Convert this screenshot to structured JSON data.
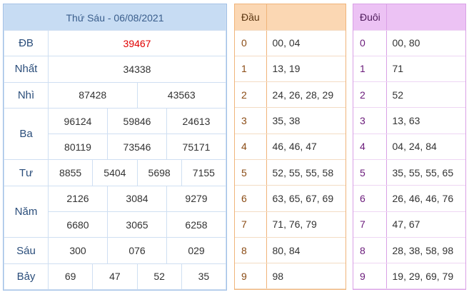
{
  "results": {
    "title": "Thứ Sáu - 06/08/2021",
    "labels": {
      "db": "ĐB",
      "nhat": "Nhất",
      "nhi": "Nhì",
      "ba": "Ba",
      "tu": "Tư",
      "nam": "Năm",
      "sau": "Sáu",
      "bay": "Bảy"
    },
    "db": "39467",
    "nhat": "34338",
    "nhi": [
      "87428",
      "43563"
    ],
    "ba": [
      "96124",
      "59846",
      "24613",
      "80119",
      "73546",
      "75171"
    ],
    "tu": [
      "8855",
      "5404",
      "5698",
      "7155"
    ],
    "nam": [
      "2126",
      "3084",
      "9279",
      "6680",
      "3065",
      "6258"
    ],
    "sau": [
      "300",
      "076",
      "029"
    ],
    "bay": [
      "69",
      "47",
      "52",
      "35"
    ],
    "special_color": "#e00000"
  },
  "dau": {
    "header": "Đầu",
    "rows": [
      {
        "key": "0",
        "vals": "00, 04"
      },
      {
        "key": "1",
        "vals": "13, 19"
      },
      {
        "key": "2",
        "vals": "24, 26, 28, 29"
      },
      {
        "key": "3",
        "vals": "35, 38"
      },
      {
        "key": "4",
        "vals": "46, 46, 47"
      },
      {
        "key": "5",
        "vals": "52, 55, 55, 58"
      },
      {
        "key": "6",
        "vals": "63, 65, 67, 69"
      },
      {
        "key": "7",
        "vals": "71, 76, 79"
      },
      {
        "key": "8",
        "vals": "80, 84"
      },
      {
        "key": "9",
        "vals": "98"
      }
    ]
  },
  "duoi": {
    "header": "Đuôi",
    "rows": [
      {
        "key": "0",
        "vals": "00, 80"
      },
      {
        "key": "1",
        "vals": "71"
      },
      {
        "key": "2",
        "vals": "52"
      },
      {
        "key": "3",
        "vals": "13, 63"
      },
      {
        "key": "4",
        "vals": "04, 24, 84"
      },
      {
        "key": "5",
        "vals": "35, 55, 55, 65"
      },
      {
        "key": "6",
        "vals": "26, 46, 46, 76"
      },
      {
        "key": "7",
        "vals": "47, 67"
      },
      {
        "key": "8",
        "vals": "28, 38, 58, 98"
      },
      {
        "key": "9",
        "vals": "19, 29, 69, 79"
      }
    ]
  }
}
